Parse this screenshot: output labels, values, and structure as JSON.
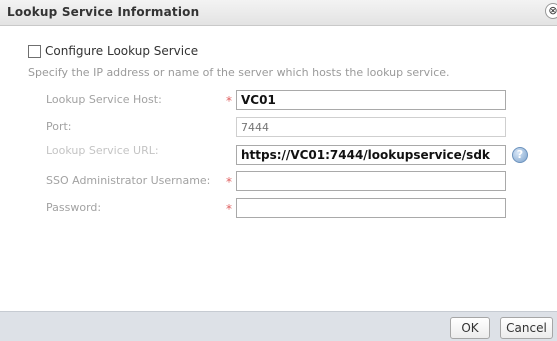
{
  "dialog": {
    "title": "Lookup Service Information",
    "close_glyph": "⊗"
  },
  "configure": {
    "checkbox_label": "Configure Lookup Service",
    "checked": false,
    "description": "Specify the IP address or name of the server which hosts the lookup service."
  },
  "fields": {
    "host": {
      "label": "Lookup Service Host:",
      "value": "VC01",
      "required": true
    },
    "port": {
      "label": "Port:",
      "placeholder": "7444",
      "value": "",
      "required": false
    },
    "url": {
      "label": "Lookup Service URL:",
      "value": "https://VC01:7444/lookupservice/sdk",
      "required": false
    },
    "sso_username": {
      "label": "SSO Administrator Username:",
      "value": "",
      "required": true
    },
    "password": {
      "label": "Password:",
      "value": "",
      "required": true
    }
  },
  "required_marker": "*",
  "help_icon_glyph": "?",
  "buttons": {
    "ok": "OK",
    "cancel": "Cancel"
  },
  "colors": {
    "required_marker": "#e06060",
    "footer_bg": "#dde1e7",
    "help_icon": "#7da3cc"
  },
  "icons": {
    "close": "close-icon",
    "help": "help-icon"
  }
}
